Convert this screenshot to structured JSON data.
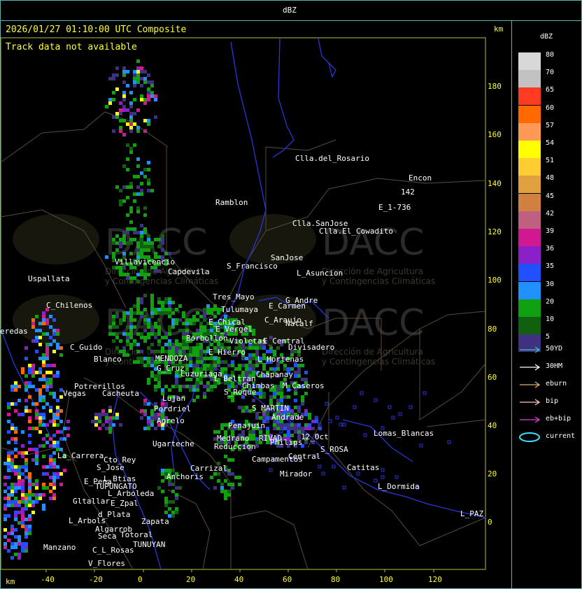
{
  "header": {
    "title": "dBZ"
  },
  "map": {
    "timestamp": "2026/01/27 01:10:00 UTC Composite",
    "status": "Track data not available",
    "unit_top": "km",
    "unit_bottom": "km",
    "x_ticks": [
      "-40",
      "-20",
      "0",
      "20",
      "40",
      "60",
      "80",
      "100",
      "120"
    ],
    "y_ticks": [
      "180",
      "160",
      "140",
      "120",
      "100",
      "80",
      "60",
      "40",
      "20",
      "0"
    ],
    "watermark": "DACC",
    "watermark_sub_1": "Dirección de Agricultura",
    "watermark_sub_2": "y Contingencias Climáticas",
    "places": [
      "Clla.del_Rosario",
      "Encon",
      "Ramblon",
      "Clla.SanJose",
      "Clla.El_Cowadito",
      "E_1-736",
      "142",
      "Villavicencio",
      "Uspallata",
      "Capdevila",
      "S_Francisco",
      "SanJose",
      "L_Asuncion",
      "C_Chilenos",
      "Tres_Mayo",
      "Tulumaya",
      "E_Carmen",
      "G_Andre",
      "C_Araujo",
      "Natalf",
      "eredas",
      "E_Chical",
      "E_Vergel",
      "E_Central",
      "Divisadero",
      "Borbollon",
      "Violetas",
      "C_Guido",
      "Blanco",
      "E_Hierro",
      "L_Hortenas",
      "MENDOZA",
      "G_Cruz",
      "Luzuriaga",
      "Chapanay",
      "L_Beltran",
      "Chimbas",
      "M_Caseros",
      "Potrerillos",
      "Vegas",
      "Cacheuta",
      "Lujan",
      "Perdriel",
      "Agrelo",
      "S_Roque",
      "S_MARTIN",
      "Andrade",
      "Penajuin",
      "RIVAD",
      "Philips",
      "12_Oct",
      "Lomas_Blancas",
      "Ugarteche",
      "La_Carrera",
      "Cto_Rey",
      "S_Jose",
      "Medrano",
      "Reduccion",
      "Campamentos",
      "Central",
      "S_ROSA",
      "Catitas",
      "E_Pena",
      "L_Btias",
      "TUPUNGATO",
      "Anchoris",
      "Carrizal",
      "Mirador",
      "L_Arboleda",
      "L_Dormida",
      "Gltallar",
      "E_Zpal",
      "d_Plata",
      "L_Arbols",
      "Zapata",
      "Algarrob",
      "Seca",
      "Totoral",
      "TUNUYAN",
      "L_PAZ",
      "Manzano",
      "C_L_Rosas",
      "V_Flores"
    ]
  },
  "legend": {
    "title": "dBZ",
    "scale": [
      {
        "label": "80",
        "color": "#d8d8d8"
      },
      {
        "label": "70",
        "color": "#c2c2c2"
      },
      {
        "label": "65",
        "color": "#ff3a22"
      },
      {
        "label": "60",
        "color": "#ff6a00"
      },
      {
        "label": "57",
        "color": "#ff9955"
      },
      {
        "label": "54",
        "color": "#ffff00"
      },
      {
        "label": "51",
        "color": "#ffcc33"
      },
      {
        "label": "48",
        "color": "#e0a040"
      },
      {
        "label": "45",
        "color": "#d08040"
      },
      {
        "label": "42",
        "color": "#c06080"
      },
      {
        "label": "39",
        "color": "#d01890"
      },
      {
        "label": "36",
        "color": "#8a20c8"
      },
      {
        "label": "35",
        "color": "#2050ff"
      },
      {
        "label": "30",
        "color": "#2090ff"
      },
      {
        "label": "20",
        "color": "#10a010"
      },
      {
        "label": "10",
        "color": "#106010"
      },
      {
        "label": "5",
        "color": "#403080"
      }
    ],
    "tracks": [
      {
        "label": "50YD",
        "color": "#40c0c0"
      },
      {
        "label": "30HM",
        "color": "#ffffff"
      },
      {
        "label": "eburn",
        "color": "#e0b070"
      },
      {
        "label": "bip",
        "color": "#ffc8c8"
      },
      {
        "label": "eb+bip",
        "color": "#e040e0"
      },
      {
        "label": "current",
        "color": "#40e0ff"
      }
    ]
  }
}
